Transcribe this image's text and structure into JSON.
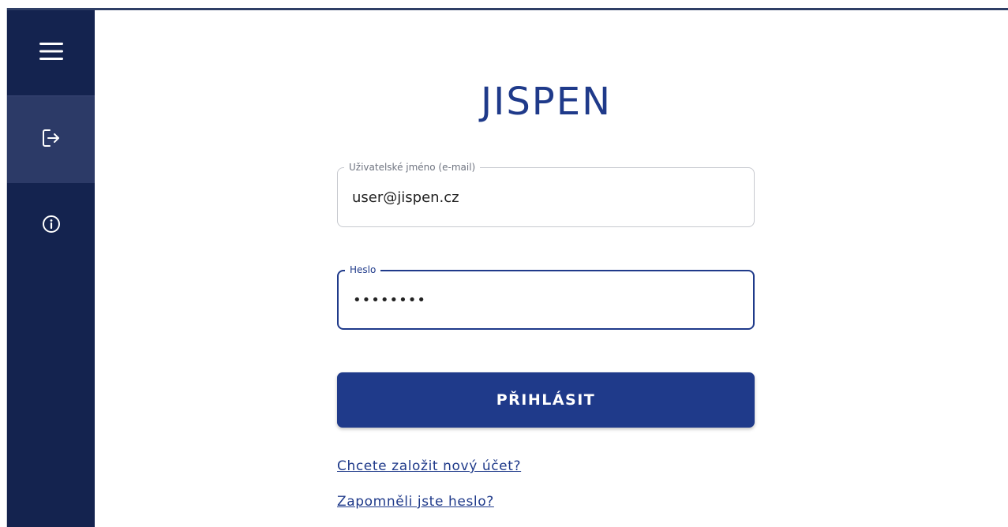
{
  "sidebar": {
    "menu_icon": "hamburger-menu-icon",
    "login_icon": "sign-in-icon",
    "info_icon": "info-circle-icon"
  },
  "login": {
    "brand": "JISPEN",
    "username_label": "Uživatelské jméno (e-mail)",
    "username_value": "user@jispen.cz",
    "password_label": "Heslo",
    "password_value": "••••••••",
    "submit_label": "PŘIHLÁSIT",
    "register_link": "Chcete založit nový účet?",
    "forgot_link": "Zapomněli jste heslo?"
  },
  "colors": {
    "sidebar": "#14234f",
    "sidebar_active": "#2c3a67",
    "primary": "#1f3a8a"
  }
}
